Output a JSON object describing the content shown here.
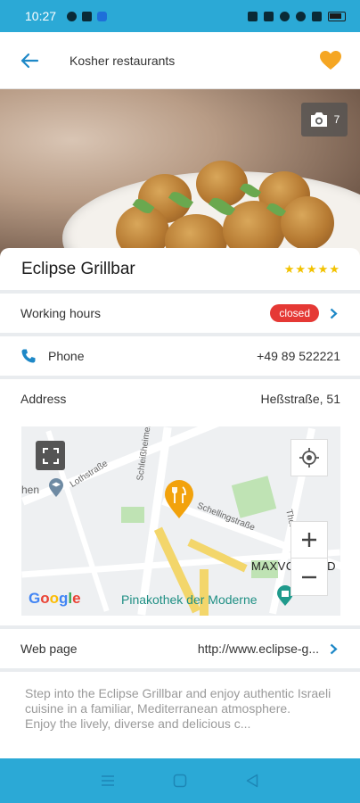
{
  "status_bar": {
    "time": "10:27",
    "battery": ""
  },
  "app_bar": {
    "title": "Kosher restaurants"
  },
  "hero": {
    "photo_count": "7"
  },
  "restaurant": {
    "name": "Eclipse Grillbar",
    "rating_stars": 5,
    "stars_text": "★★★★★"
  },
  "working_hours": {
    "label": "Working hours",
    "status": "closed"
  },
  "phone": {
    "label": "Phone",
    "value": "+49 89 522221"
  },
  "address": {
    "label": "Address",
    "value": "Heßstraße, 51"
  },
  "map": {
    "street_labels": [
      "Lothstraße",
      "Schleißheimer Str.",
      "Schellingstraße",
      "Theresienstr."
    ],
    "partial_label": "hen",
    "poi": "Pinakothek der Moderne",
    "district": "MAXVORSTAD",
    "google": [
      "G",
      "o",
      "o",
      "g",
      "l",
      "e"
    ]
  },
  "web_page": {
    "label": "Web page",
    "value": "http://www.eclipse-g..."
  },
  "description": {
    "line1": "Step into the Eclipse Grillbar and enjoy authentic Israeli cuisine in a familiar, Mediterranean atmosphere.",
    "line2": "Enjoy the lively, diverse and delicious c..."
  },
  "colors": {
    "accent": "#2ba9d6",
    "favorite": "#f5a623",
    "closed": "#e53935",
    "stars": "#f2c200"
  }
}
